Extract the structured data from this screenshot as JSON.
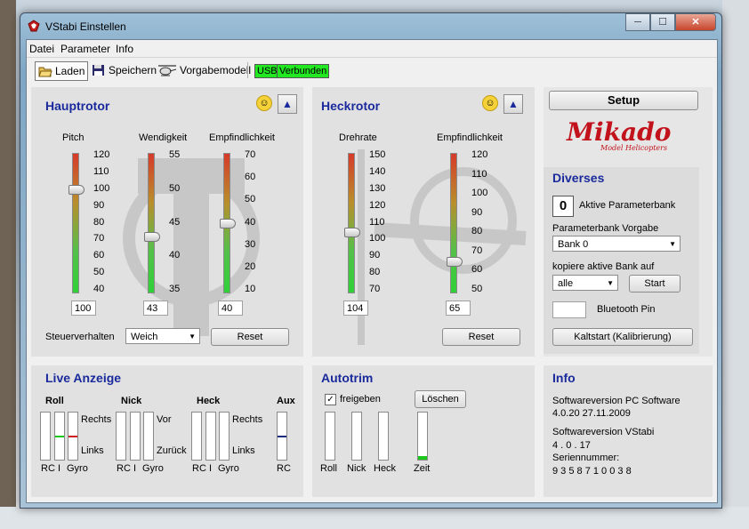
{
  "window": {
    "title": "VStabi Einstellen",
    "min": "─",
    "max": "☐",
    "close": "✕"
  },
  "menu": {
    "items": [
      "Datei",
      "Parameter",
      "Info"
    ]
  },
  "toolbar": {
    "load": "Laden",
    "save": "Speichern",
    "default_model": "Vorgabemodell",
    "usb": "USB",
    "connected": "Verbunden"
  },
  "hauptrotor": {
    "title": "Hauptrotor",
    "labels": [
      "Pitch",
      "Wendigkeit",
      "Empfindlichkeit"
    ],
    "pitch": {
      "scale": [
        "120",
        "110",
        "100",
        "90",
        "80",
        "70",
        "60",
        "50",
        "40"
      ],
      "value": "100",
      "level": 0.75
    },
    "wendigkeit": {
      "scale": [
        "55",
        "50",
        "45",
        "40",
        "35"
      ],
      "value": "43",
      "level": 0.4
    },
    "empfindlichkeit": {
      "scale": [
        "70",
        "60",
        "50",
        "40",
        "30",
        "20",
        "10"
      ],
      "value": "40",
      "level": 0.5
    },
    "steuerverhalten_label": "Steuerverhalten",
    "steuerverhalten_value": "Weich",
    "reset": "Reset"
  },
  "heckrotor": {
    "title": "Heckrotor",
    "labels": [
      "Drehrate",
      "Empfindlichkeit"
    ],
    "drehrate": {
      "scale": [
        "150",
        "140",
        "130",
        "120",
        "110",
        "100",
        "90",
        "80",
        "70"
      ],
      "value": "104",
      "level": 0.43
    },
    "empfindlichkeit": {
      "scale": [
        "120",
        "110",
        "100",
        "90",
        "80",
        "70",
        "60",
        "50"
      ],
      "value": "65",
      "level": 0.21
    },
    "reset": "Reset"
  },
  "setup": {
    "button": "Setup",
    "logo_text": "Mikado",
    "logo_sub": "Model Helicopters"
  },
  "diverses": {
    "title": "Diverses",
    "active_bank_number": "0",
    "active_bank_label": "Aktive Parameterbank",
    "bank_default_label": "Parameterbank Vorgabe",
    "bank_default_value": "Bank 0",
    "copy_label": "kopiere aktive Bank auf",
    "copy_value": "alle",
    "start": "Start",
    "bluetooth_label": "Bluetooth Pin",
    "bluetooth_value": "",
    "coldstart": "Kaltstart (Kalibrierung)"
  },
  "live": {
    "title": "Live Anzeige",
    "groups": {
      "roll": {
        "title": "Roll",
        "top": "Rechts",
        "bottom": "Links"
      },
      "nick": {
        "title": "Nick",
        "top": "Vor",
        "bottom": "Zurück"
      },
      "heck": {
        "title": "Heck",
        "top": "Rechts",
        "bottom": "Links"
      },
      "aux": {
        "title": "Aux",
        "bottom": "RC"
      }
    },
    "bar_labels": {
      "rc": "RC",
      "i": "I",
      "gyro": "Gyro"
    },
    "colors": {
      "green": "#1cc81c",
      "red": "#d02020",
      "navy": "#1a2a7c"
    }
  },
  "autotrim": {
    "title": "Autotrim",
    "checkbox_label": "freigeben",
    "checkbox_checked": "✓",
    "delete": "Löschen",
    "bars": [
      "Roll",
      "Nick",
      "Heck",
      "Zeit"
    ]
  },
  "info": {
    "title": "Info",
    "pc_label": "Softwareversion PC Software",
    "pc_value": "4.0.20  27.11.2009",
    "vstabi_label": "Softwareversion VStabi",
    "vstabi_value": "4 . 0 . 17",
    "serial_label": "Seriennummer:",
    "serial_value": "9 3 5 8 7 1 0 0 3 8"
  }
}
